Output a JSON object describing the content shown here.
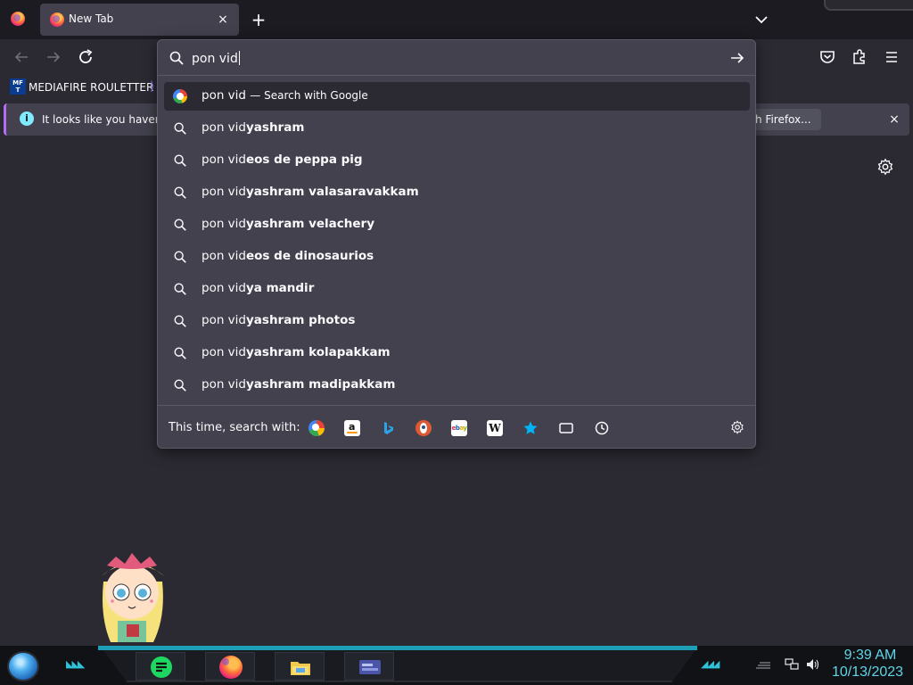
{
  "browser": {
    "tab": {
      "title": "New Tab",
      "close_glyph": "×"
    },
    "new_tab_glyph": "+",
    "bookmarks": [
      {
        "icon_text": "MF\nT",
        "label": "MEDIAFIRE ROULETTER"
      }
    ],
    "notification": {
      "icon_glyph": "i",
      "text": "It looks like you haven't s",
      "action_label": "h Firefox...",
      "close_glyph": "×"
    }
  },
  "urlbar": {
    "input_value": "pon vid",
    "results": [
      {
        "typed": "pon vid",
        "completion": "",
        "suffix": "— Search with Google",
        "icon": "google-icon",
        "selected": true
      },
      {
        "typed": "pon vid",
        "completion": "yashram",
        "icon": "search-icon"
      },
      {
        "typed": "pon vid",
        "completion": "eos de peppa pig",
        "icon": "search-icon"
      },
      {
        "typed": "pon vid",
        "completion": "yashram valasaravakkam",
        "icon": "search-icon"
      },
      {
        "typed": "pon vid",
        "completion": "yashram velachery",
        "icon": "search-icon"
      },
      {
        "typed": "pon vid",
        "completion": "eos de dinosaurios",
        "icon": "search-icon"
      },
      {
        "typed": "pon vid",
        "completion": "ya mandir",
        "icon": "search-icon"
      },
      {
        "typed": "pon vid",
        "completion": "yashram photos",
        "icon": "search-icon"
      },
      {
        "typed": "pon vid",
        "completion": "yashram kolapakkam",
        "icon": "search-icon"
      },
      {
        "typed": "pon vid",
        "completion": "yashram madipakkam",
        "icon": "search-icon"
      }
    ],
    "oneoff_label": "This time, search with:",
    "engines": [
      "google-icon",
      "amazon-icon",
      "bing-icon",
      "duckduckgo-icon",
      "ebay-icon",
      "wikipedia-icon",
      "bookmarks-icon",
      "tabs-icon",
      "history-icon"
    ]
  },
  "taskbar": {
    "clock_time": "9:39 AM",
    "clock_date": "10/13/2023",
    "apps": [
      "notes-app-icon",
      "firefox-icon",
      "file-explorer-icon",
      "control-panel-icon"
    ]
  },
  "colors": {
    "frame": "#1c1b22",
    "toolbar": "#2b2a33",
    "popup": "#42414d",
    "accent_cyan": "#5fd6e8"
  }
}
